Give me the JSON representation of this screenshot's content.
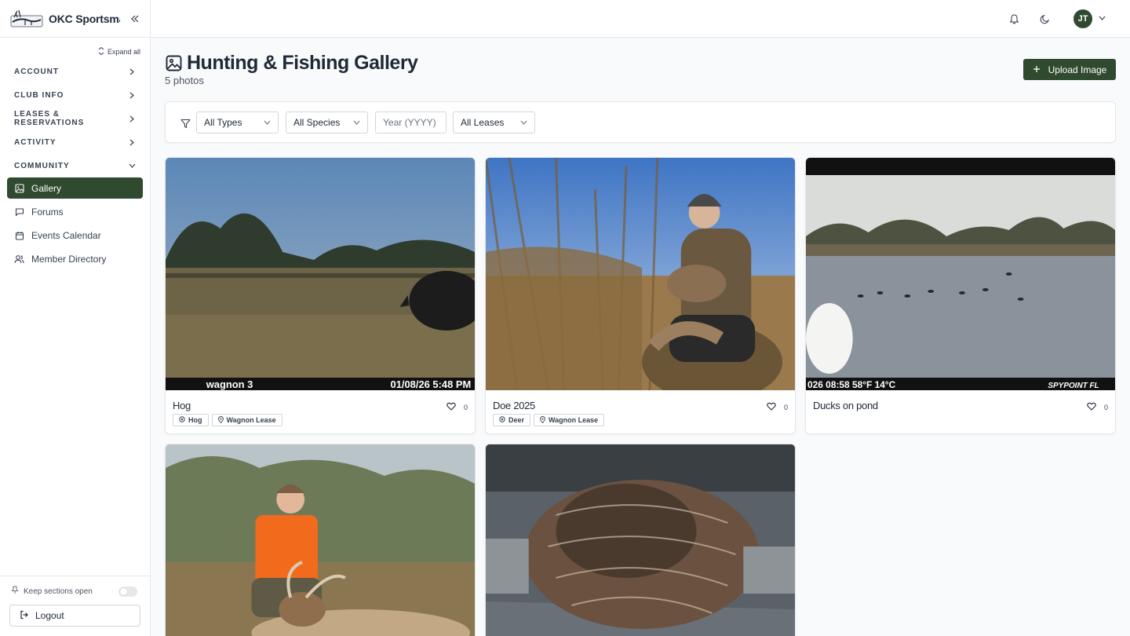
{
  "brand": {
    "name": "OKC Sportsma..."
  },
  "sidebar": {
    "expand_all": "Expand all",
    "sections": [
      {
        "label": "ACCOUNT",
        "expanded": false
      },
      {
        "label": "CLUB INFO",
        "expanded": false
      },
      {
        "label": "LEASES & RESERVATIONS",
        "expanded": false
      },
      {
        "label": "ACTIVITY",
        "expanded": false
      },
      {
        "label": "COMMUNITY",
        "expanded": true
      }
    ],
    "items": [
      {
        "label": "Gallery",
        "icon": "image-icon",
        "active": true
      },
      {
        "label": "Forums",
        "icon": "message-square-icon",
        "active": false
      },
      {
        "label": "Events Calendar",
        "icon": "calendar-icon",
        "active": false
      },
      {
        "label": "Member Directory",
        "icon": "users-icon",
        "active": false
      }
    ],
    "keep_open": {
      "label": "Keep sections open",
      "on": false
    },
    "logout": "Logout"
  },
  "topbar": {
    "avatar_initials": "JT"
  },
  "page": {
    "title": "Hunting & Fishing Gallery",
    "count": "5 photos",
    "upload_label": "Upload Image"
  },
  "filters": {
    "type": "All Types",
    "species": "All Species",
    "year_placeholder": "Year (YYYY)",
    "lease": "All Leases"
  },
  "photos": [
    {
      "caption": "Hog",
      "likes": "0",
      "tags": [
        "Hog",
        "Wagnon Lease"
      ],
      "overlay_left": "wagnon 3",
      "overlay_right": "01/08/26 5:48 PM"
    },
    {
      "caption": "Doe 2025",
      "likes": "0",
      "tags": [
        "Deer",
        "Wagnon Lease"
      ]
    },
    {
      "caption": "Ducks on pond",
      "likes": "0",
      "tags": [],
      "overlay_text": "026  08:58  58°F  14°C",
      "overlay_brand": "SPYPOINT FL"
    },
    {
      "caption": "",
      "likes": "",
      "tags": []
    },
    {
      "caption": "",
      "likes": "",
      "tags": []
    }
  ],
  "colors": {
    "accent": "#2f4a2f",
    "border": "#e5e7eb",
    "background": "#f9fafb"
  }
}
